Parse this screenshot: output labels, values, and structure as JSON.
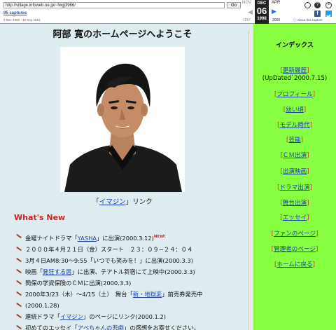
{
  "toolbar": {
    "url": "http://village.infoweb.ne.jp/~fwgj3966/",
    "go_label": "Go",
    "captures_label": "95 captures",
    "date_range": "5 Dec 1998 - 30 Sep 2016",
    "prev_month": "NOV",
    "current_month": "DEC",
    "current_day": "06",
    "current_year": "1998",
    "next_month": "APR",
    "prev_year": "1997",
    "next_year": "2000",
    "about_label": "ⓘ About this capture"
  },
  "main": {
    "title": "阿部 寛のホームページへようこそ",
    "photo_caption_link": "イマジン",
    "photo_caption_rest": "リンク",
    "whats_new_heading": "What's New",
    "news": [
      {
        "pre": "金曜ナイトドラマ",
        "link": "YASHA",
        "post": "に出演(2000.3.12)",
        "badge": "NEW!"
      },
      {
        "pre": "２０００年４月２１日（金）スタート　２３：０９−２４：０４",
        "link": "",
        "post": "",
        "badge": ""
      },
      {
        "pre": "3月４日AM8:30〜9:55「いつでも笑みを！」に出演(2000.3.3)",
        "link": "",
        "post": "",
        "badge": ""
      },
      {
        "pre": "映画",
        "link": "発狂する唇",
        "post": "に出演、テアトル新宿にて上映中(2000.3.3)",
        "badge": ""
      },
      {
        "pre": "簡保の学資保険のＣＭに出演(2000.3.3)",
        "link": "",
        "post": "",
        "badge": ""
      },
      {
        "pre": "2000年3/23（木）〜4/15（土）　舞台",
        "link": "新・地獄変",
        "post": "前売券発売中",
        "badge": ""
      },
      {
        "pre": "(2000.1.28)",
        "link": "",
        "post": "",
        "badge": ""
      },
      {
        "pre": "連続ドラマ",
        "link": "イマジン",
        "post": "のページにリンク(2000.1.2)",
        "badge": ""
      },
      {
        "pre": "初めてのエッセイ",
        "link": "アベちゃんの悲劇",
        "post": "の感想をお寄せください。",
        "badge": ""
      }
    ]
  },
  "sidebar": {
    "title": "インデックス",
    "items": [
      {
        "label": "更新履歴"
      },
      {
        "label": "(UpDated`2000.7.15)",
        "plain": true
      },
      {
        "label": "プロフィール"
      },
      {
        "label": "幼い頃"
      },
      {
        "label": "モデル時代"
      },
      {
        "label": "芸能"
      },
      {
        "label": "ＣＭ出演"
      },
      {
        "label": "出演映画"
      },
      {
        "label": "ドラマ出演"
      },
      {
        "label": "舞台出演"
      },
      {
        "label": "エッセイ"
      },
      {
        "label": "ファンのページ"
      },
      {
        "label": "管理者のページ"
      },
      {
        "label": "ホームに戻る"
      }
    ]
  },
  "colors": {
    "content_bg": "#deecf0",
    "sidebar_bg": "#88ff40",
    "whats_new": "#cc2222",
    "link": "#1a3fa8"
  }
}
